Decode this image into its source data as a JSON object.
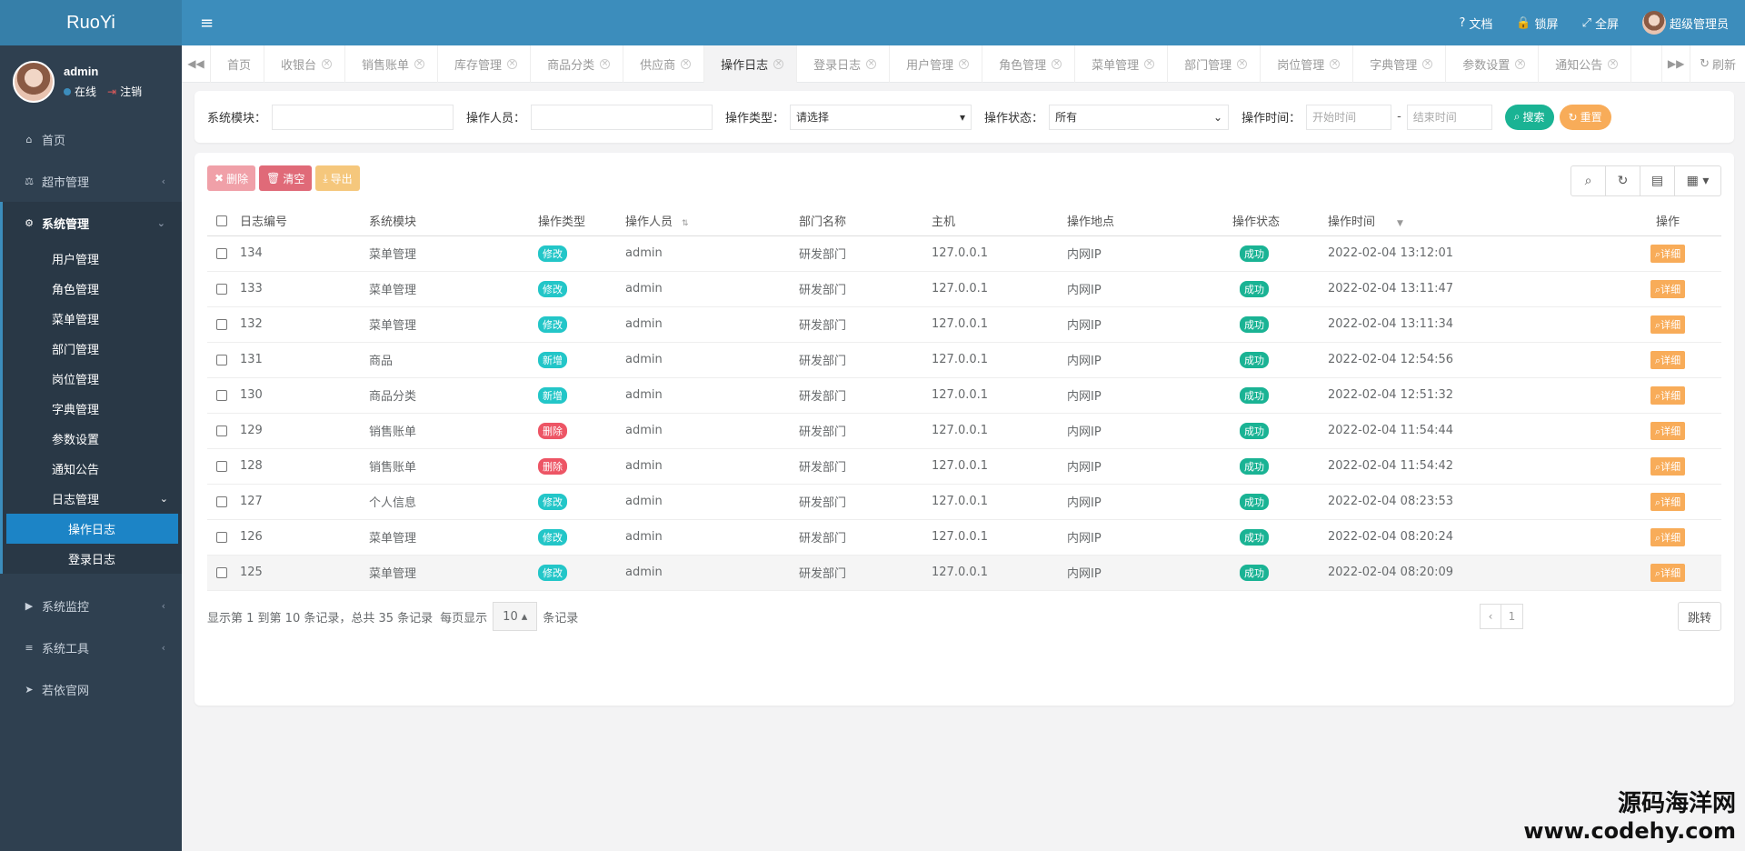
{
  "app": {
    "logo": "RuoYi"
  },
  "user": {
    "name": "admin",
    "status": "在线",
    "logout": "注销"
  },
  "topbar": {
    "docs": "文档",
    "lock": "锁屏",
    "fullscreen": "全屏",
    "username": "超级管理员"
  },
  "sidebar": {
    "home": "首页",
    "market": "超市管理",
    "system": "系统管理",
    "sub_items": [
      "用户管理",
      "角色管理",
      "菜单管理",
      "部门管理",
      "岗位管理",
      "字典管理",
      "参数设置",
      "通知公告"
    ],
    "log": "日志管理",
    "log_items": [
      "操作日志",
      "登录日志"
    ],
    "monitor": "系统监控",
    "tools": "系统工具",
    "website": "若依官网"
  },
  "tabs": [
    "首页",
    "收银台",
    "销售账单",
    "库存管理",
    "商品分类",
    "供应商",
    "操作日志",
    "登录日志",
    "用户管理",
    "角色管理",
    "菜单管理",
    "部门管理",
    "岗位管理",
    "字典管理",
    "参数设置",
    "通知公告"
  ],
  "tabs_refresh": "刷新",
  "search": {
    "module_label": "系统模块：",
    "operator_label": "操作人员：",
    "type_label": "操作类型：",
    "type_value": "请选择",
    "status_label": "操作状态：",
    "status_value": "所有",
    "time_label": "操作时间：",
    "start_placeholder": "开始时间",
    "end_placeholder": "结束时间",
    "dash": "-",
    "search_btn": "搜索",
    "reset_btn": "重置"
  },
  "toolbar": {
    "delete": "删除",
    "clear": "清空",
    "export": "导出"
  },
  "table": {
    "headers": [
      "日志编号",
      "系统模块",
      "操作类型",
      "操作人员",
      "部门名称",
      "主机",
      "操作地点",
      "操作状态",
      "操作时间",
      "操作"
    ],
    "detail": "详细",
    "rows": [
      {
        "id": "134",
        "module": "菜单管理",
        "type": "修改",
        "type_kind": "edit",
        "user": "admin",
        "dept": "研发部门",
        "host": "127.0.0.1",
        "loc": "内网IP",
        "status": "成功",
        "time": "2022-02-04 13:12:01"
      },
      {
        "id": "133",
        "module": "菜单管理",
        "type": "修改",
        "type_kind": "edit",
        "user": "admin",
        "dept": "研发部门",
        "host": "127.0.0.1",
        "loc": "内网IP",
        "status": "成功",
        "time": "2022-02-04 13:11:47"
      },
      {
        "id": "132",
        "module": "菜单管理",
        "type": "修改",
        "type_kind": "edit",
        "user": "admin",
        "dept": "研发部门",
        "host": "127.0.0.1",
        "loc": "内网IP",
        "status": "成功",
        "time": "2022-02-04 13:11:34"
      },
      {
        "id": "131",
        "module": "商品",
        "type": "新增",
        "type_kind": "add",
        "user": "admin",
        "dept": "研发部门",
        "host": "127.0.0.1",
        "loc": "内网IP",
        "status": "成功",
        "time": "2022-02-04 12:54:56"
      },
      {
        "id": "130",
        "module": "商品分类",
        "type": "新增",
        "type_kind": "add",
        "user": "admin",
        "dept": "研发部门",
        "host": "127.0.0.1",
        "loc": "内网IP",
        "status": "成功",
        "time": "2022-02-04 12:51:32"
      },
      {
        "id": "129",
        "module": "销售账单",
        "type": "删除",
        "type_kind": "del",
        "user": "admin",
        "dept": "研发部门",
        "host": "127.0.0.1",
        "loc": "内网IP",
        "status": "成功",
        "time": "2022-02-04 11:54:44"
      },
      {
        "id": "128",
        "module": "销售账单",
        "type": "删除",
        "type_kind": "del",
        "user": "admin",
        "dept": "研发部门",
        "host": "127.0.0.1",
        "loc": "内网IP",
        "status": "成功",
        "time": "2022-02-04 11:54:42"
      },
      {
        "id": "127",
        "module": "个人信息",
        "type": "修改",
        "type_kind": "edit",
        "user": "admin",
        "dept": "研发部门",
        "host": "127.0.0.1",
        "loc": "内网IP",
        "status": "成功",
        "time": "2022-02-04 08:23:53"
      },
      {
        "id": "126",
        "module": "菜单管理",
        "type": "修改",
        "type_kind": "edit",
        "user": "admin",
        "dept": "研发部门",
        "host": "127.0.0.1",
        "loc": "内网IP",
        "status": "成功",
        "time": "2022-02-04 08:20:24"
      },
      {
        "id": "125",
        "module": "菜单管理",
        "type": "修改",
        "type_kind": "edit",
        "user": "admin",
        "dept": "研发部门",
        "host": "127.0.0.1",
        "loc": "内网IP",
        "status": "成功",
        "time": "2022-02-04 08:20:09"
      }
    ]
  },
  "pagination": {
    "summary": "显示第 1 到第 10 条记录，总共 35 条记录",
    "per_page_prefix": "每页显示",
    "page_size": "10",
    "per_page_suffix": "条记录",
    "prev": "‹",
    "current": "1",
    "jump": "跳转"
  },
  "watermark": {
    "line1": "源码海洋网",
    "line2": "www.codehy.com"
  },
  "colors": {
    "primary": "#3c8dbc",
    "sidebar": "#2f4050",
    "green": "#1ab394",
    "orange": "#f8ac59",
    "red": "#ed5565",
    "cyan": "#23c6c8"
  }
}
